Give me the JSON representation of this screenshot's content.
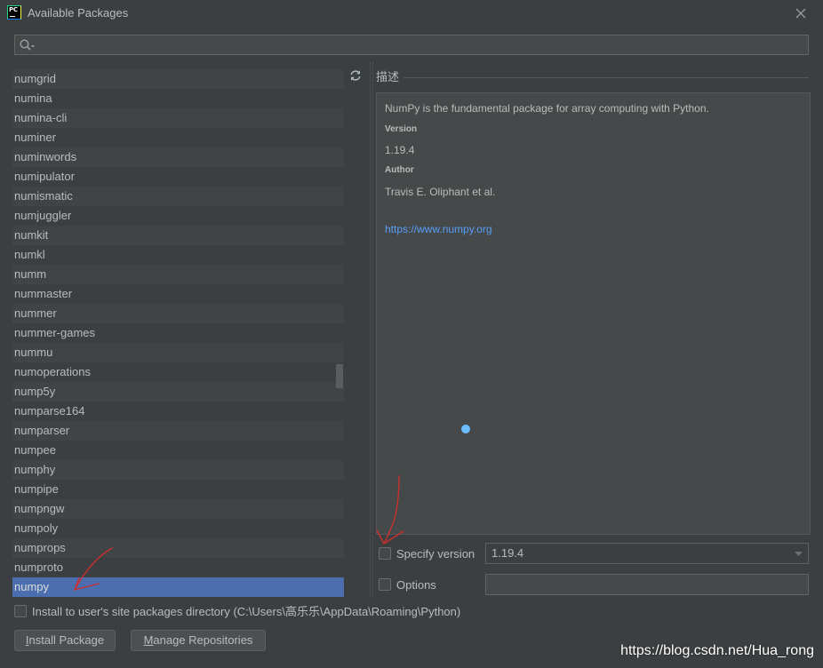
{
  "window": {
    "app_icon_text": "PC",
    "title": "Available Packages"
  },
  "search": {
    "value": ""
  },
  "packages": {
    "items": [
      {
        "name": "numgrid"
      },
      {
        "name": "numina"
      },
      {
        "name": "numina-cli"
      },
      {
        "name": "numiner"
      },
      {
        "name": "numinwords"
      },
      {
        "name": "numipulator"
      },
      {
        "name": "numismatic"
      },
      {
        "name": "numjuggler"
      },
      {
        "name": "numkit"
      },
      {
        "name": "numkl"
      },
      {
        "name": "numm"
      },
      {
        "name": "nummaster"
      },
      {
        "name": "nummer"
      },
      {
        "name": "nummer-games"
      },
      {
        "name": "nummu"
      },
      {
        "name": "numoperations"
      },
      {
        "name": "nump5y"
      },
      {
        "name": "numparse164"
      },
      {
        "name": "numparser"
      },
      {
        "name": "numpee"
      },
      {
        "name": "numphy"
      },
      {
        "name": "numpipe"
      },
      {
        "name": "numpngw"
      },
      {
        "name": "numpoly"
      },
      {
        "name": "numprops"
      },
      {
        "name": "numproto"
      },
      {
        "name": "numpy",
        "selected": true
      }
    ]
  },
  "description": {
    "heading": "描述",
    "summary": "NumPy is the fundamental package for array computing with Python.",
    "version_label": "Version",
    "version": "1.19.4",
    "author_label": "Author",
    "author": "Travis E. Oliphant et al.",
    "homepage": "https://www.numpy.org"
  },
  "specify_version": {
    "label": "Specify version",
    "checked": false,
    "selected_version": "1.19.4"
  },
  "options": {
    "label": "Options",
    "checked": false,
    "value": ""
  },
  "install_to_user": {
    "label": "Install to user's site packages directory (C:\\Users\\高乐乐\\AppData\\Roaming\\Python)",
    "checked": false
  },
  "buttons": {
    "install_package": "Install Package",
    "manage_repositories": "Manage Repositories"
  },
  "watermark": "https://blog.csdn.net/Hua_rong",
  "colors": {
    "background": "#3c3f41",
    "text": "#bbbbbb",
    "selection": "#4b6eaf",
    "stripe": "#414446",
    "link": "#589df6",
    "annotation": "#c8302e"
  },
  "icons": {
    "app": "pycharm-logo-icon",
    "close": "close-icon",
    "search": "search-icon",
    "refresh": "refresh-icon",
    "dropdown": "chevron-down-icon"
  }
}
